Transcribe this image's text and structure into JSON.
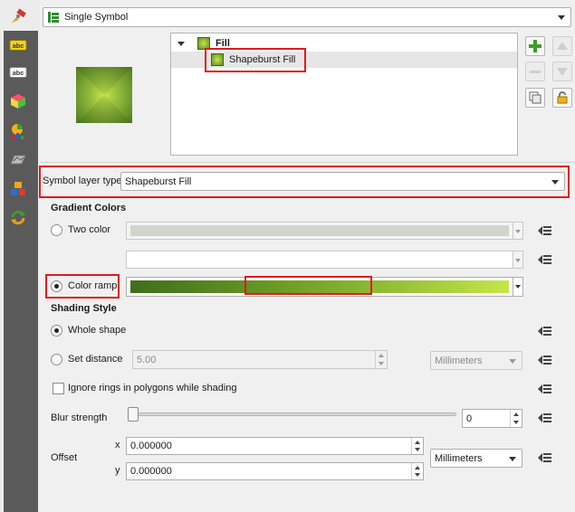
{
  "renderer": {
    "selected": "Single Symbol"
  },
  "layer_tree": {
    "root_label": "Fill",
    "child_label": "Shapeburst Fill"
  },
  "symbol_layer_type": {
    "label": "Symbol layer type",
    "selected": "Shapeburst Fill"
  },
  "gradient_colors": {
    "heading": "Gradient Colors",
    "two_color_label": "Two color",
    "color_ramp_label": "Color ramp",
    "two_color_checked": false,
    "color_ramp_checked": true
  },
  "shading_style": {
    "heading": "Shading Style",
    "whole_shape_label": "Whole shape",
    "set_distance_label": "Set distance",
    "distance_value": "5.00",
    "distance_unit": "Millimeters",
    "whole_shape_checked": true
  },
  "ignore_rings": {
    "label": "Ignore rings in polygons while shading",
    "checked": false
  },
  "blur": {
    "label": "Blur strength",
    "value": "0",
    "level": 0
  },
  "offset": {
    "label": "Offset",
    "x_label": "x",
    "y_label": "y",
    "x_value": "0.000000",
    "y_value": "0.000000",
    "unit": "Millimeters"
  },
  "colors": {
    "highlight": "#e01b1b",
    "ramp_start": "#3f6e1c",
    "ramp_end": "#c6e54a"
  },
  "icons": {
    "sidebar": [
      "paint-brush-icon",
      "label-abc-icon",
      "label-abc-outline-icon",
      "3d-cube-icon",
      "diagram-icon",
      "fields-icon",
      "layers-stack-icon",
      "refresh-arrows-icon"
    ],
    "tool_buttons": [
      "add-layer-icon",
      "move-up-icon",
      "remove-layer-icon",
      "move-down-icon",
      "duplicate-layer-icon",
      "lock-icon"
    ]
  }
}
